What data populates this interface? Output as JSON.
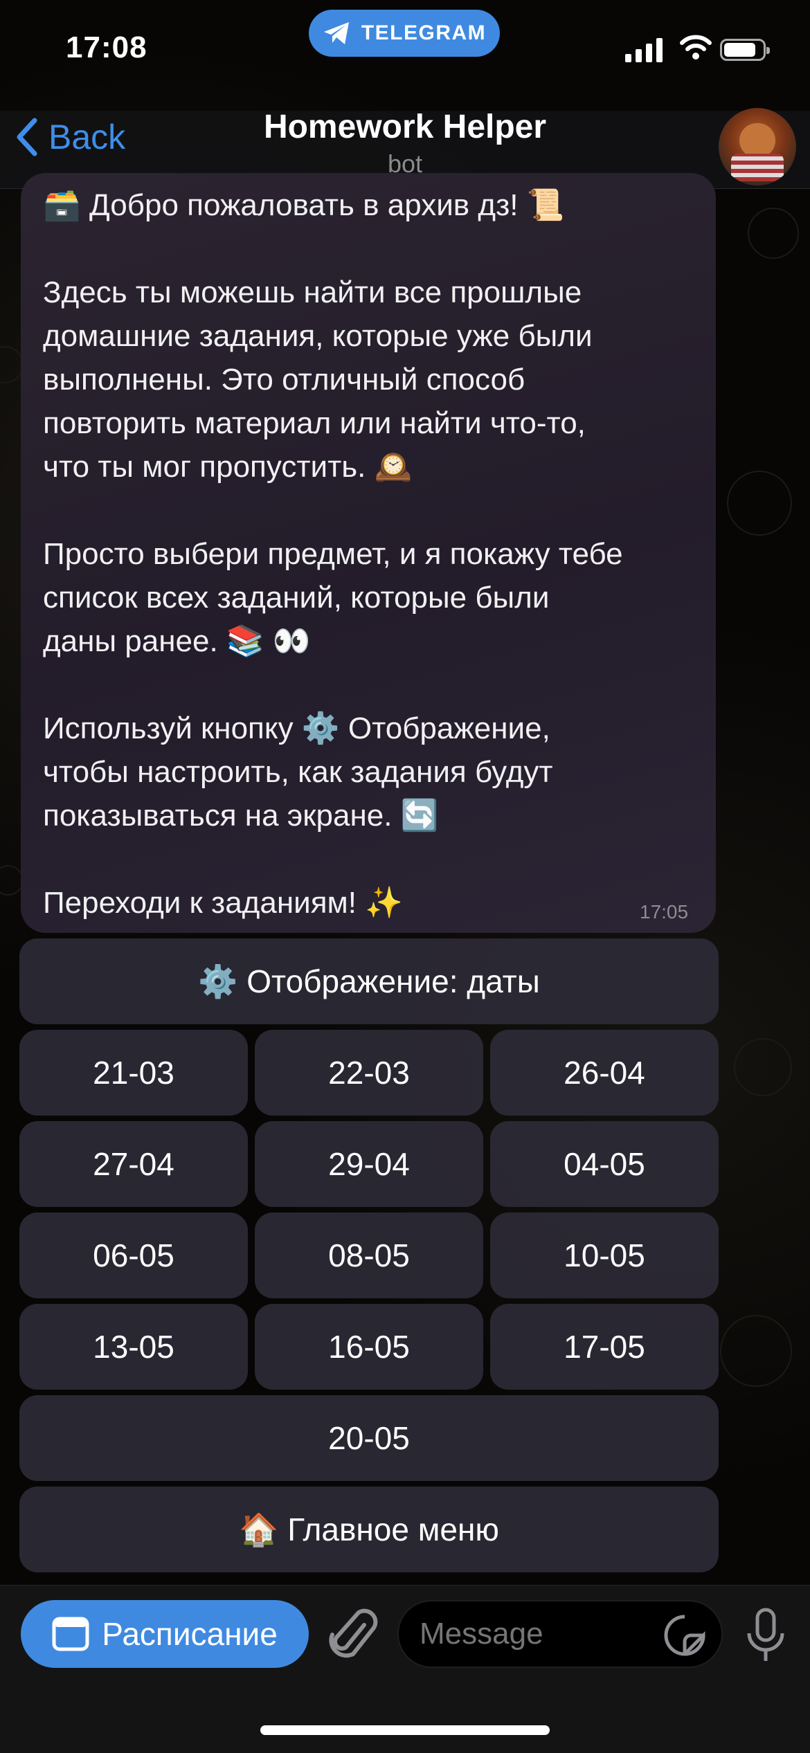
{
  "status_bar": {
    "time": "17:08",
    "app_pill": "TELEGRAM"
  },
  "header": {
    "back_label": "Back",
    "title": "Homework Helper",
    "subtitle": "bot"
  },
  "message": {
    "text": "🗃️ Добро пожаловать в архив дз! 📜\n\nЗдесь ты можешь найти все прошлые\nдомашние задания, которые уже были\nвыполнены. Это отличный способ\nповторить материал или найти что-то,\nчто ты мог пропустить. 🕰️\n\nПросто выбери предмет, и я покажу тебе\nсписок всех заданий, которые были\nданы ранее. 📚 👀\n\nИспользуй кнопку ⚙️ Отображение,\nчтобы настроить, как задания будут\nпоказываться на экране. 🔄\n\nПереходи к заданиям! ✨",
    "time": "17:05"
  },
  "keyboard": {
    "display_toggle": "⚙️ Отображение: даты",
    "dates": [
      "21-03",
      "22-03",
      "26-04",
      "27-04",
      "29-04",
      "04-05",
      "06-05",
      "08-05",
      "10-05",
      "13-05",
      "16-05",
      "17-05"
    ],
    "last_date": "20-05",
    "main_menu": "🏠 Главное меню"
  },
  "input_bar": {
    "schedule_label": "Расписание",
    "message_placeholder": "Message"
  },
  "colors": {
    "accent": "#3f8ae0",
    "bubble": "#2b2430",
    "button": "#2c2a36"
  }
}
